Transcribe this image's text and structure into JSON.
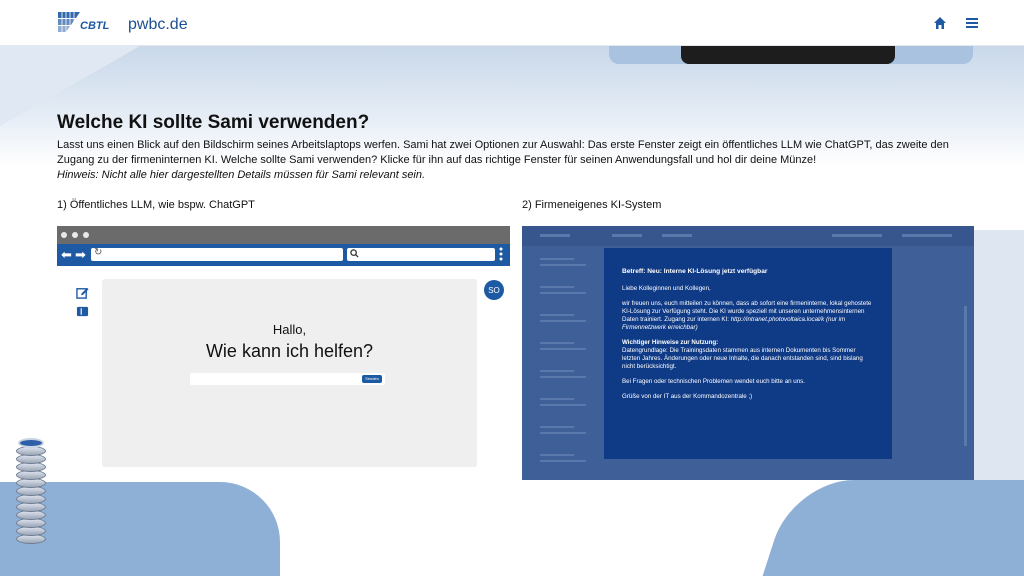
{
  "header": {
    "logo_text": "CBTL",
    "site_name": "pwbc.de",
    "home_icon": "home-icon",
    "menu_icon": "hamburger-menu-icon"
  },
  "main": {
    "title": "Welche KI sollte Sami verwenden?",
    "description": "Lasst uns einen Blick auf den Bildschirm seines Arbeitslaptops werfen. Sami hat zwei Optionen zur Auswahl: Das erste Fenster zeigt ein öffentliches LLM wie ChatGPT, das zweite den Zugang zu der firmeninternen KI. Welche sollte Sami verwenden? Klicke für ihn auf das richtige Fenster für seinen Anwendungsfall und hol dir deine Münze!",
    "hint": "Hinweis: Nicht alle hier dargestellten Details müssen für Sami relevant sein.",
    "option1_label": "1) Öffentliches LLM, wie bspw. ChatGPT",
    "option2_label": "2) Firmeneigenes KI-System"
  },
  "window1": {
    "avatar_initials": "SO",
    "greeting": "Hallo,",
    "question": "Wie kann ich helfen?",
    "send_label": "Senden"
  },
  "window2": {
    "email_subject": "Betreff: Neu: Interne KI-Lösung jetzt verfügbar",
    "salutation": "Liebe Kolleginnen und Kollegen,",
    "body_intro": "wir freuen uns, euch mitteilen zu können, dass ab sofort eine firmeninterne, lokal gehostete KI-Lösung zur Verfügung steht. Die KI wurde speziell mit unseren unternehmensinternen Daten trainiert. Zugang zur internen KI: ",
    "link_text": "http://intranet.photovoltaica.local/k (nur im Firmennetzwerk erreichbar)",
    "notice_heading": "Wichtiger Hinweise zur Nutzung:",
    "notice_body": "Datengrundlage: Die Trainingsdaten stammen aus internen Dokumenten bis Sommer letzten Jahres. Änderungen oder neue Inhalte, die danach entstanden sind, sind bislang nicht berücksichtigt.",
    "support_text": "Bei Fragen oder technischen Problemen wendet euch bitte an uns.",
    "closing": "Grüße von der IT aus der Kommandozentrale ;)"
  },
  "colors": {
    "brand_blue": "#1e5aa3",
    "email_bg": "#0f3a86",
    "window2_bg": "#3e5f97"
  }
}
